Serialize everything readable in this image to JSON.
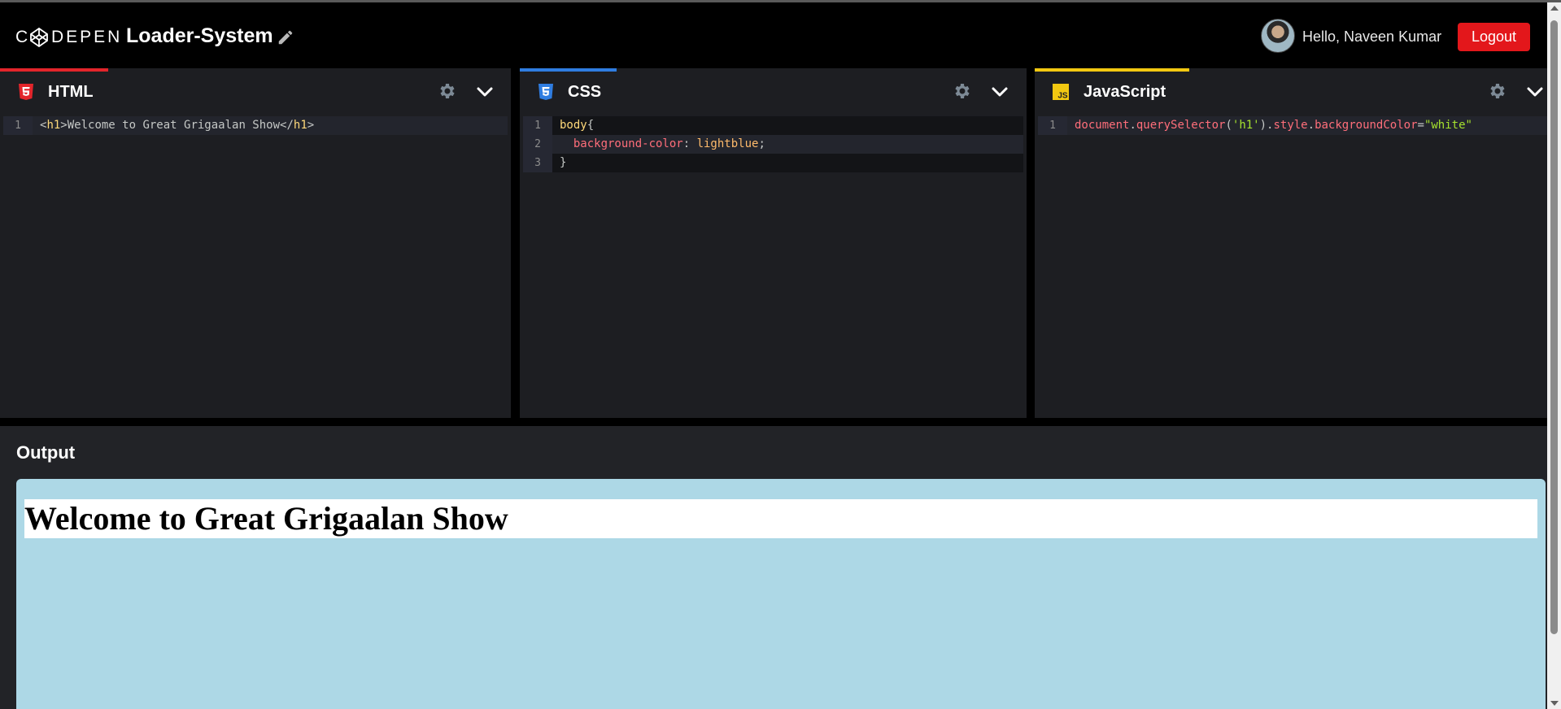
{
  "header": {
    "logo_text": "CODEPEN",
    "project_title": "Loader-System",
    "greeting": "Hello, Naveen Kumar",
    "logout_label": "Logout"
  },
  "panels": {
    "html": {
      "title": "HTML",
      "accent": "#e3252b",
      "lines": [
        {
          "no": "1",
          "code": "<h1>Welcome to Great Grigaalan Show</h1>"
        }
      ]
    },
    "css": {
      "title": "CSS",
      "accent": "#2f7de1",
      "lines": [
        {
          "no": "1",
          "code": "body{"
        },
        {
          "no": "2",
          "code": "  background-color: lightblue;"
        },
        {
          "no": "3",
          "code": "}"
        }
      ]
    },
    "js": {
      "title": "JavaScript",
      "accent": "#f2c811",
      "lines": [
        {
          "no": "1",
          "code": "document.querySelector('h1').style.backgroundColor=\"white\""
        }
      ]
    }
  },
  "output": {
    "label": "Output",
    "heading": "Welcome to Great Grigaalan Show",
    "background": "lightblue"
  },
  "colors": {
    "logout_bg": "#e3171b",
    "editor_bg": "#1d1e22",
    "output_bg": "#222327"
  }
}
